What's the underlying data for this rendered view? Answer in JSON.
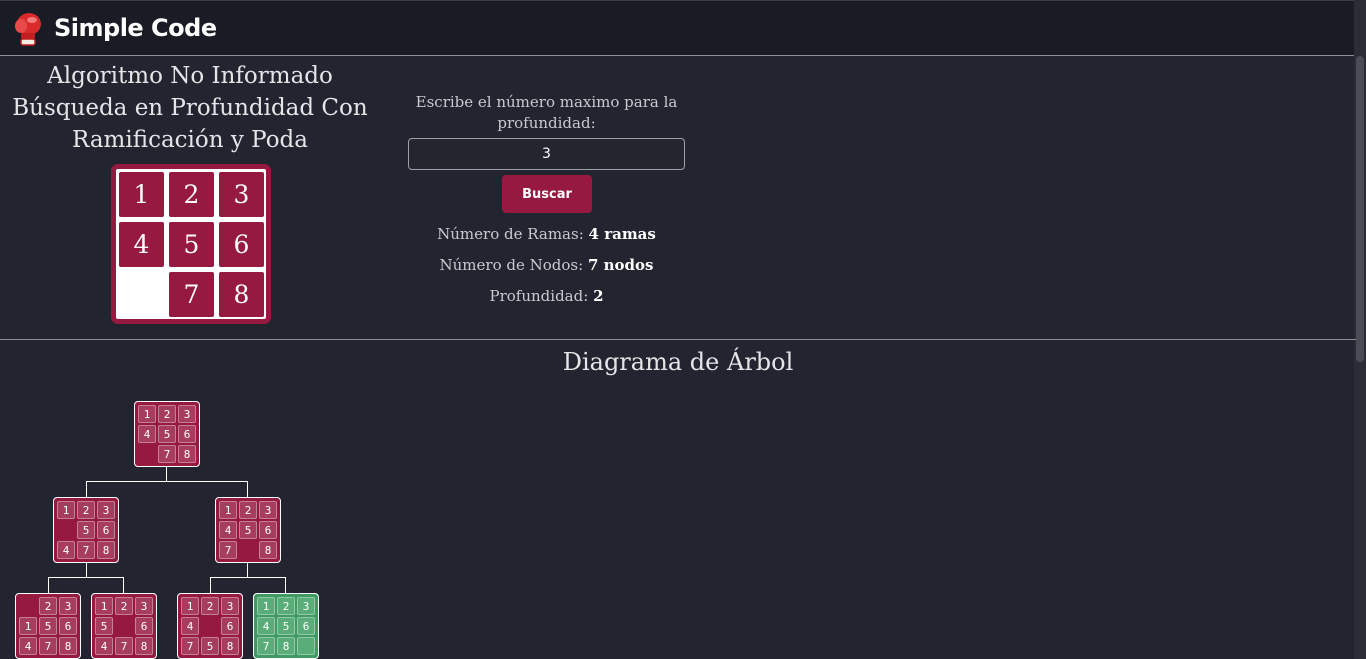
{
  "header": {
    "brand": "Simple Code",
    "logo_icon": "boxing-glove-icon"
  },
  "main": {
    "title_lines": [
      "Algoritmo No Informado",
      "Búsqueda en Profundidad Con",
      "Ramificación y Poda"
    ],
    "puzzle": [
      "1",
      "2",
      "3",
      "4",
      "5",
      "6",
      "",
      "7",
      "8"
    ],
    "form": {
      "label": "Escribe el número maximo para la profundidad:",
      "value": "3",
      "button": "Buscar"
    },
    "stats": {
      "branches_label": "Número de Ramas:",
      "branches_value": "4 ramas",
      "nodes_label": "Número de Nodos:",
      "nodes_value": "7 nodos",
      "depth_label": "Profundidad:",
      "depth_value": "2"
    }
  },
  "tree": {
    "title": "Diagrama de Árbol",
    "nodes": [
      {
        "tiles": [
          "1",
          "2",
          "3",
          "4",
          "5",
          "6",
          "",
          "7",
          "8"
        ],
        "state": "explored"
      },
      {
        "tiles": [
          "1",
          "2",
          "3",
          "",
          "5",
          "6",
          "4",
          "7",
          "8"
        ],
        "state": "explored"
      },
      {
        "tiles": [
          "1",
          "2",
          "3",
          "4",
          "5",
          "6",
          "7",
          "",
          "8"
        ],
        "state": "explored"
      },
      {
        "tiles": [
          "",
          "2",
          "3",
          "1",
          "5",
          "6",
          "4",
          "7",
          "8"
        ],
        "state": "explored"
      },
      {
        "tiles": [
          "1",
          "2",
          "3",
          "5",
          "",
          "6",
          "4",
          "7",
          "8"
        ],
        "state": "explored"
      },
      {
        "tiles": [
          "1",
          "2",
          "3",
          "4",
          "",
          "6",
          "7",
          "5",
          "8"
        ],
        "state": "explored"
      },
      {
        "tiles": [
          "1",
          "2",
          "3",
          "4",
          "5",
          "6",
          "7",
          "8",
          ""
        ],
        "state": "goal"
      }
    ]
  },
  "colors": {
    "accent": "#96193f",
    "goal": "#3f9b63",
    "background": "#22252f",
    "header": "#191c24"
  }
}
